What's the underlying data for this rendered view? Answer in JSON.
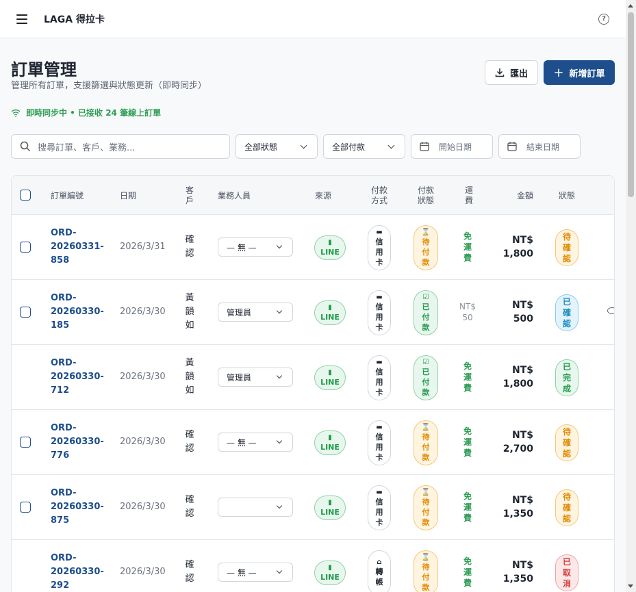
{
  "app": {
    "brand": "LAGA 得拉卡"
  },
  "header": {
    "title": "訂單管理",
    "subtitle": "管理所有訂單，支援篩選與狀態更新（即時同步）",
    "export_label": "匯出",
    "new_label": "新增訂單"
  },
  "sync": {
    "text": "即時同步中 • 已接收 24 筆線上訂單"
  },
  "filters": {
    "search_placeholder": "搜尋訂單、客戶、業務...",
    "status": "全部狀態",
    "payment": "全部付款",
    "start_date": "開始日期",
    "end_date": "結束日期"
  },
  "columns": [
    "訂單編號",
    "日期",
    "客戶",
    "業務人員",
    "來源",
    "付款方式",
    "付款狀態",
    "運費",
    "金額",
    "狀態"
  ],
  "rows": [
    {
      "order1": "ORD-",
      "order2": "20260331-",
      "order3": "858",
      "date": "2026/3/31",
      "cust": [
        "確",
        "認"
      ],
      "sales": "— 無 —",
      "source": "LINE",
      "pay": [
        "信",
        "用",
        "卡"
      ],
      "paystatus": [
        "待",
        "付",
        "款"
      ],
      "paystatus_type": "wait",
      "ship": [
        "免",
        "運",
        "費"
      ],
      "amt1": "NT$",
      "amt2": "1,800",
      "status": [
        "待",
        "確",
        "認"
      ],
      "status_type": "pending",
      "checkbox": true
    },
    {
      "order1": "ORD-",
      "order2": "20260330-",
      "order3": "185",
      "date": "2026/3/30",
      "cust": [
        "黃",
        "韻",
        "如"
      ],
      "sales": "管理員",
      "source": "LINE",
      "pay": [
        "信",
        "用",
        "卡"
      ],
      "paystatus": [
        "已",
        "付",
        "款"
      ],
      "paystatus_type": "paid",
      "ship": [
        "NT$",
        "50"
      ],
      "ship_type": "gray",
      "amt1": "NT$",
      "amt2": "500",
      "status": [
        "已",
        "確",
        "認"
      ],
      "status_type": "confirmed",
      "checkbox": true
    },
    {
      "order1": "ORD-",
      "order2": "20260330-",
      "order3": "712",
      "date": "2026/3/30",
      "cust": [
        "黃",
        "韻",
        "如"
      ],
      "sales": "管理員",
      "source": "LINE",
      "pay": [
        "信",
        "用",
        "卡"
      ],
      "paystatus": [
        "已",
        "付",
        "款"
      ],
      "paystatus_type": "paid",
      "ship": [
        "免",
        "運",
        "費"
      ],
      "amt1": "NT$",
      "amt2": "1,800",
      "status": [
        "已",
        "完",
        "成"
      ],
      "status_type": "done",
      "checkbox": false
    },
    {
      "order1": "ORD-",
      "order2": "20260330-",
      "order3": "776",
      "date": "2026/3/30",
      "cust": [
        "確",
        "認"
      ],
      "sales": "— 無 —",
      "source": "LINE",
      "pay": [
        "信",
        "用",
        "卡"
      ],
      "paystatus": [
        "待",
        "付",
        "款"
      ],
      "paystatus_type": "wait",
      "ship": [
        "免",
        "運",
        "費"
      ],
      "amt1": "NT$",
      "amt2": "2,700",
      "status": [
        "待",
        "確",
        "認"
      ],
      "status_type": "pending",
      "checkbox": true
    },
    {
      "order1": "ORD-",
      "order2": "20260330-",
      "order3": "875",
      "date": "2026/3/30",
      "cust": [
        "確",
        "認"
      ],
      "sales": "",
      "source": "LINE",
      "pay": [
        "信",
        "用",
        "卡"
      ],
      "paystatus": [
        "待",
        "付",
        "款"
      ],
      "paystatus_type": "wait",
      "ship": [
        "免",
        "運",
        "費"
      ],
      "amt1": "NT$",
      "amt2": "1,350",
      "status": [
        "待",
        "確",
        "認"
      ],
      "status_type": "pending",
      "checkbox": true
    },
    {
      "order1": "ORD-",
      "order2": "20260330-",
      "order3": "292",
      "date": "2026/3/30",
      "cust": [
        "確",
        "認"
      ],
      "sales": "— 無 —",
      "source": "LINE",
      "pay": [
        "轉",
        "帳"
      ],
      "paystatus": [
        "待",
        "付",
        "款"
      ],
      "paystatus_type": "wait",
      "ship": [
        "免",
        "運",
        "費"
      ],
      "amt1": "NT$",
      "amt2": "1,350",
      "status": [
        "已",
        "取",
        "消"
      ],
      "status_type": "cancel",
      "checkbox": false
    }
  ]
}
